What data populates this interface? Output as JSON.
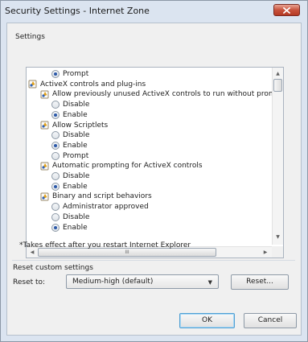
{
  "window": {
    "title": "Security Settings - Internet Zone"
  },
  "settings": {
    "label": "Settings",
    "rows": [
      {
        "kind": "radio",
        "label": "Prompt",
        "selected": true
      },
      {
        "kind": "group",
        "label": "ActiveX controls and plug-ins",
        "icon": "settings-group-icon"
      },
      {
        "kind": "setting",
        "label": "Allow previously unused ActiveX controls to run without prom",
        "icon": "setting-icon"
      },
      {
        "kind": "radio",
        "label": "Disable",
        "selected": false
      },
      {
        "kind": "radio",
        "label": "Enable",
        "selected": true
      },
      {
        "kind": "setting",
        "label": "Allow Scriptlets",
        "icon": "setting-icon"
      },
      {
        "kind": "radio",
        "label": "Disable",
        "selected": false
      },
      {
        "kind": "radio",
        "label": "Enable",
        "selected": true
      },
      {
        "kind": "radio",
        "label": "Prompt",
        "selected": false
      },
      {
        "kind": "setting",
        "label": "Automatic prompting for ActiveX controls",
        "icon": "setting-icon"
      },
      {
        "kind": "radio",
        "label": "Disable",
        "selected": false
      },
      {
        "kind": "radio",
        "label": "Enable",
        "selected": true
      },
      {
        "kind": "setting",
        "label": "Binary and script behaviors",
        "icon": "setting-icon"
      },
      {
        "kind": "radio",
        "label": "Administrator approved",
        "selected": false
      },
      {
        "kind": "radio",
        "label": "Disable",
        "selected": false
      },
      {
        "kind": "radio",
        "label": "Enable",
        "selected": true
      }
    ],
    "hscroll_grip": "III"
  },
  "note": "*Takes effect after you restart Internet Explorer",
  "reset": {
    "group_title": "Reset custom settings",
    "reset_to_label": "Reset to:",
    "level_value": "Medium-high (default)",
    "reset_button": "Reset..."
  },
  "footer": {
    "ok": "OK",
    "cancel": "Cancel"
  },
  "colors": {
    "title_bg": "#dbe4f0",
    "close_red": "#c8523c",
    "radio_dot": "#2c59a8"
  }
}
